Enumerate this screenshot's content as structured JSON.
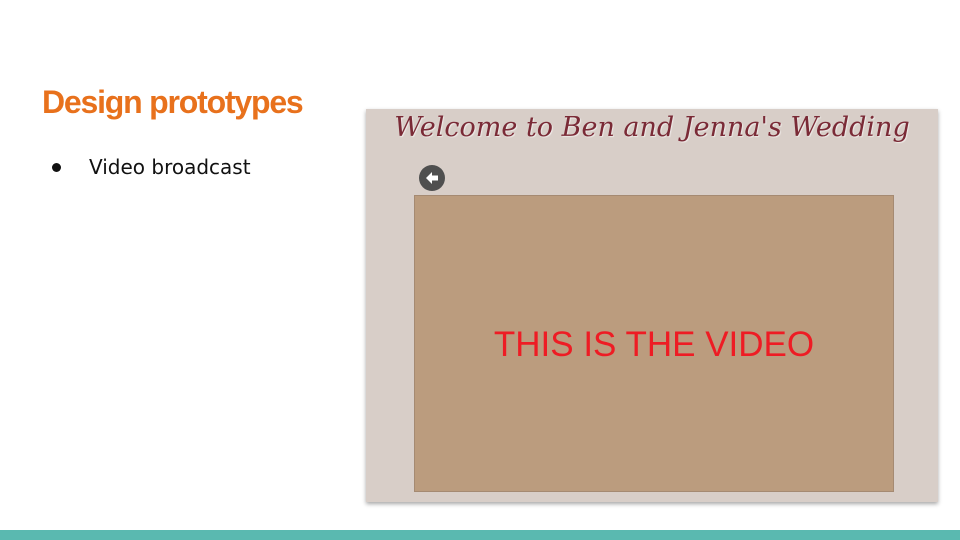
{
  "slide": {
    "title": "Design prototypes",
    "bullets": [
      {
        "label": "Video broadcast"
      }
    ]
  },
  "mockup": {
    "banner": "Welcome to Ben and Jenna's Wedding",
    "back_button_icon": "arrow-left-icon",
    "video_placeholder": "THIS IS THE VIDEO"
  },
  "colors": {
    "title": "#e8711c",
    "mockup_background": "#d8cec8",
    "banner_text": "#7a2a36",
    "video_background": "#bb9c7e",
    "video_placeholder_text": "#ee1c24",
    "back_button": "#4f4f4f",
    "footer_accent": "#5ab9b0"
  }
}
